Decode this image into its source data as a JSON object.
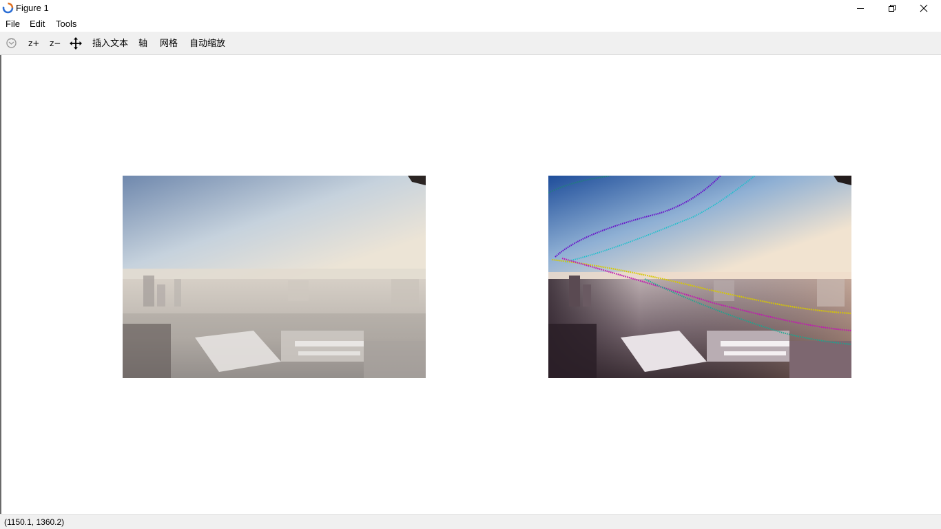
{
  "window": {
    "title": "Figure 1",
    "icon": "matlab-style-figure-icon",
    "controls": [
      "minimize-icon",
      "restore-icon",
      "close-icon"
    ]
  },
  "menubar": {
    "items": [
      "File",
      "Edit",
      "Tools"
    ]
  },
  "toolbar": {
    "rotate_icon": "rotate-icon",
    "zoom_in_label": "z+",
    "zoom_out_label": "z−",
    "pan_icon": "pan-move-icon",
    "insert_text_label": "插入文本",
    "axis_label": "轴",
    "grid_label": "网格",
    "autoscale_label": "自动缩放"
  },
  "figure": {
    "panels": [
      {
        "name": "original-hazy-image"
      },
      {
        "name": "dehazed-image-with-feature-tracks"
      }
    ],
    "track_colors": [
      "#6a16c9",
      "#1ec0cc",
      "#c01ab0",
      "#d6c800",
      "#16a890",
      "#20807a"
    ]
  },
  "statusbar": {
    "coords": "(1150.1, 1360.2)"
  }
}
